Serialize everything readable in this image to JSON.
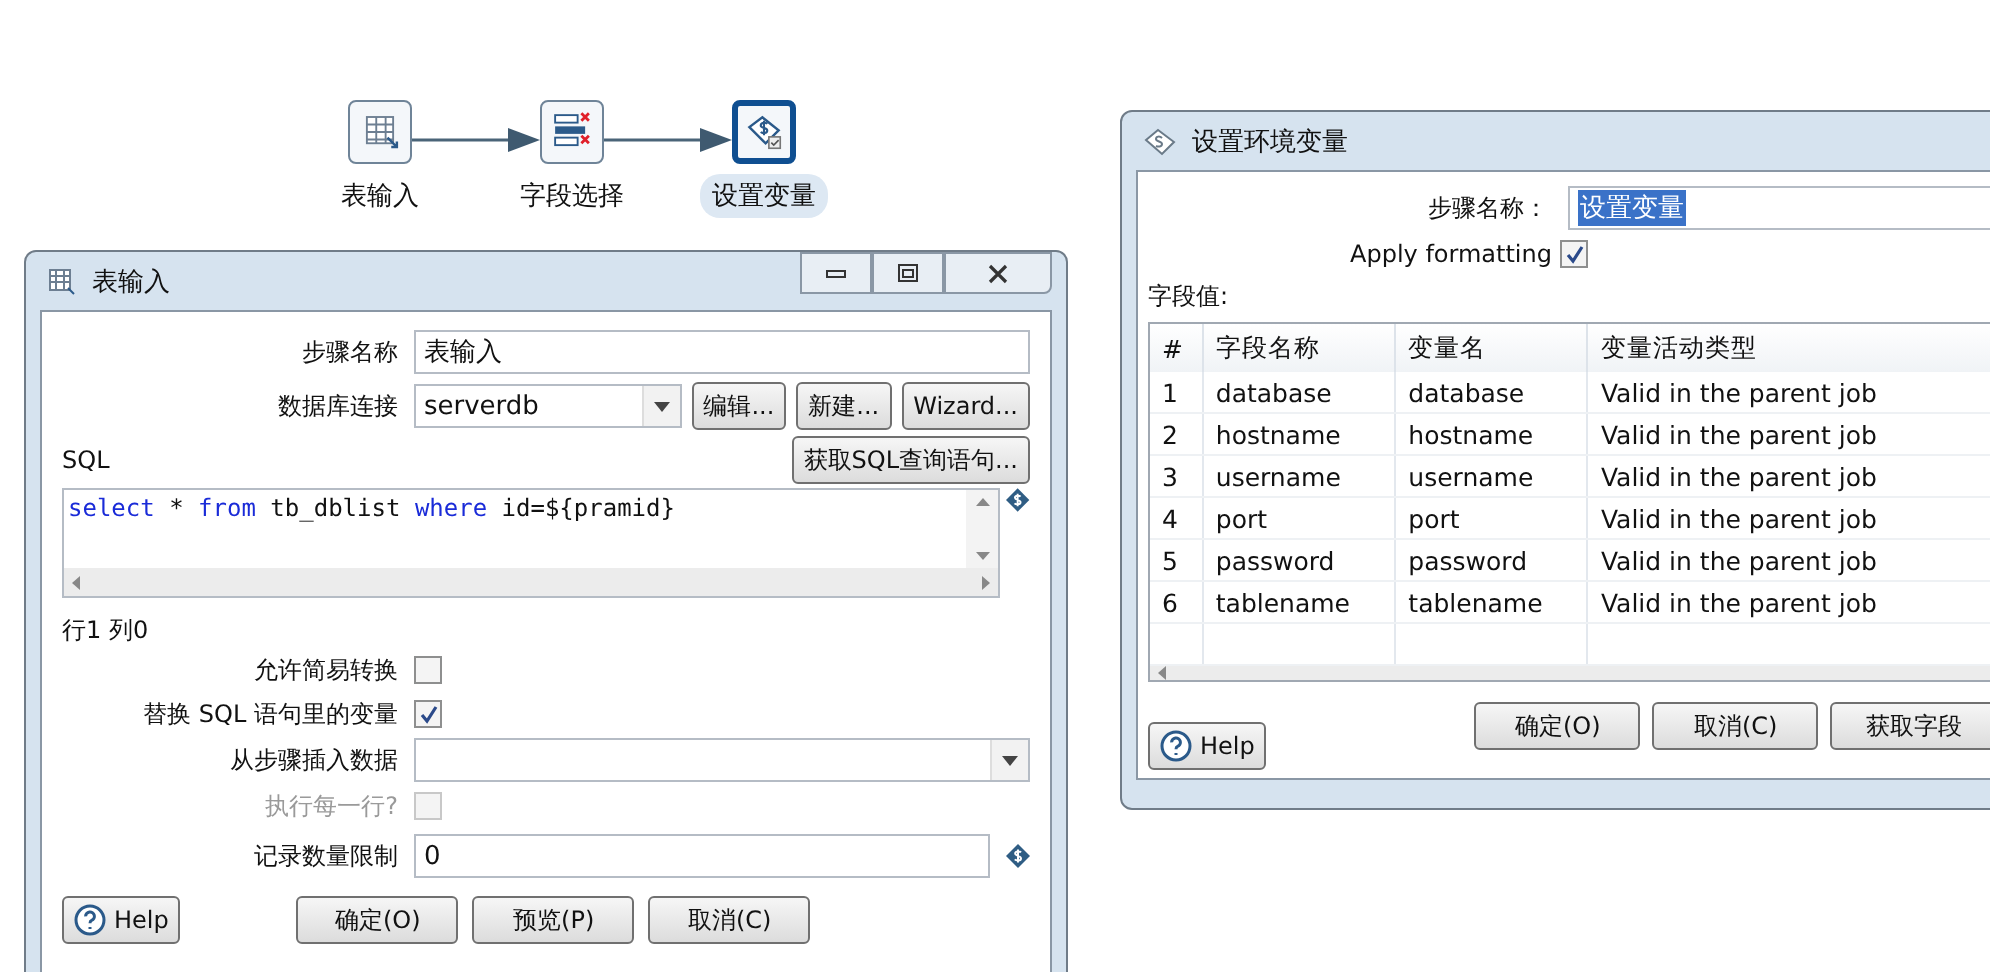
{
  "flow": {
    "nodes": [
      {
        "label": "表输入",
        "kind": "table",
        "selected": false
      },
      {
        "label": "字段选择",
        "kind": "select",
        "selected": false
      },
      {
        "label": "设置变量",
        "kind": "variable",
        "selected": true
      }
    ]
  },
  "table_input_dialog": {
    "title": "表输入",
    "step_name_label": "步骤名称",
    "step_name": "表输入",
    "connection_label": "数据库连接",
    "connection": "serverdb",
    "connection_buttons": [
      "编辑...",
      "新建...",
      "Wizard..."
    ],
    "sql_label": "SQL",
    "get_sql_button": "获取SQL查询语句...",
    "sql_tokens": [
      {
        "text": "select",
        "kind": "keyword"
      },
      {
        "text": " * ",
        "kind": "plain"
      },
      {
        "text": "from",
        "kind": "keyword"
      },
      {
        "text": " tb_dblist ",
        "kind": "plain"
      },
      {
        "text": "where",
        "kind": "keyword"
      },
      {
        "text": " id=${pramid}",
        "kind": "plain"
      }
    ],
    "cursor_position": "行1 列0",
    "options": [
      {
        "kind": "checkbox",
        "label": "允许简易转换",
        "checked": false,
        "disabled": false
      },
      {
        "kind": "checkbox",
        "label": "替换 SQL 语句里的变量",
        "checked": true,
        "disabled": false
      },
      {
        "kind": "dropdown",
        "label": "从步骤插入数据"
      },
      {
        "kind": "checkbox",
        "label": "执行每一行?",
        "checked": false,
        "disabled": true
      },
      {
        "kind": "text",
        "label": "记录数量限制",
        "value": "0"
      }
    ],
    "help_button": "Help",
    "buttons": [
      "确定(O)",
      "预览(P)",
      "取消(C)"
    ]
  },
  "set_variables_dialog": {
    "title": "设置环境变量",
    "step_name_label": "步骤名称：",
    "step_name": "设置变量",
    "apply_formatting": {
      "label": "Apply formatting",
      "checked": true
    },
    "fields_label": "字段值:",
    "table": {
      "columns": [
        "#",
        "字段名称",
        "变量名",
        "变量活动类型"
      ],
      "rows": [
        [
          "1",
          "database",
          "database",
          "Valid in the parent job"
        ],
        [
          "2",
          "hostname",
          "hostname",
          "Valid in the parent job"
        ],
        [
          "3",
          "username",
          "username",
          "Valid in the parent job"
        ],
        [
          "4",
          "port",
          "port",
          "Valid in the parent job"
        ],
        [
          "5",
          "password",
          "password",
          "Valid in the parent job"
        ],
        [
          "6",
          "tablename",
          "tablename",
          "Valid in the parent job"
        ]
      ]
    },
    "help_button": "Help",
    "buttons": [
      "确定(O)",
      "取消(C)",
      "获取字段"
    ]
  }
}
